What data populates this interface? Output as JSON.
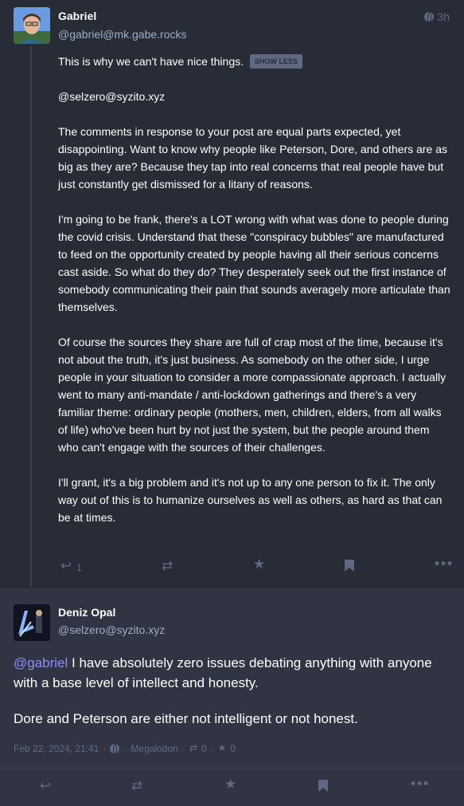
{
  "colors": {
    "bg": "#282c37",
    "focused_bg": "#313543",
    "text": "#ffffff",
    "secondary": "#9baec8",
    "muted": "#606984",
    "mention": "#8c8dff"
  },
  "post1": {
    "author_name": "Gabriel",
    "author_handle": "@gabriel@mk.gabe.rocks",
    "relative_time": "3h",
    "visibility_icon": "globe-icon",
    "cw_text": "This is why we can't have nice things.",
    "show_less_label": "SHOW LESS",
    "mention_line": "@selzero@syzito.xyz",
    "paragraphs": [
      "The comments in response to your post are equal parts expected, yet disappointing. Want to know why people like Peterson, Dore, and others are as big as they are? Because they tap into real concerns that real people have but just constantly get dismissed for a litany of reasons.",
      "I'm going to be frank, there's a LOT wrong with what was done to people during the covid crisis. Understand that these \"conspiracy bubbles\" are manufactured to feed on the opportunity created by people having all their serious concerns cast aside. So what do they do? They desperately seek out the first instance of somebody communicating their pain that sounds averagely more articulate than themselves.",
      "Of course the sources they share are full of crap most of the time, because it's not about the truth, it's just business. As somebody on the other side, I urge people in your situation to consider a more compassionate approach. I actually went to many anti-mandate / anti-lockdown gatherings and there's a very familiar theme: ordinary people (mothers, men, children, elders, from all walks of life)  who've been hurt by not just the system, but the people around them who can't engage with the sources of their challenges.",
      "I'll grant, it's a big problem and it's not up to any one person to fix it. The only way out of this is to humanize ourselves as well as others, as hard as that can be at times."
    ],
    "reply_count": "1"
  },
  "post2": {
    "author_name": "Deniz Opal",
    "author_handle": "@selzero@syzito.xyz",
    "mention": "@gabriel",
    "text_line1_rest": " I have absolutely zero issues debating anything with anyone with a base level of intellect and honesty.",
    "paragraph2": "Dore and Peterson are either not intelligent or not honest.",
    "date": "Feb 22, 2024, 21:41",
    "client": "Megalodon",
    "boost_count": "0",
    "fav_count": "0"
  }
}
